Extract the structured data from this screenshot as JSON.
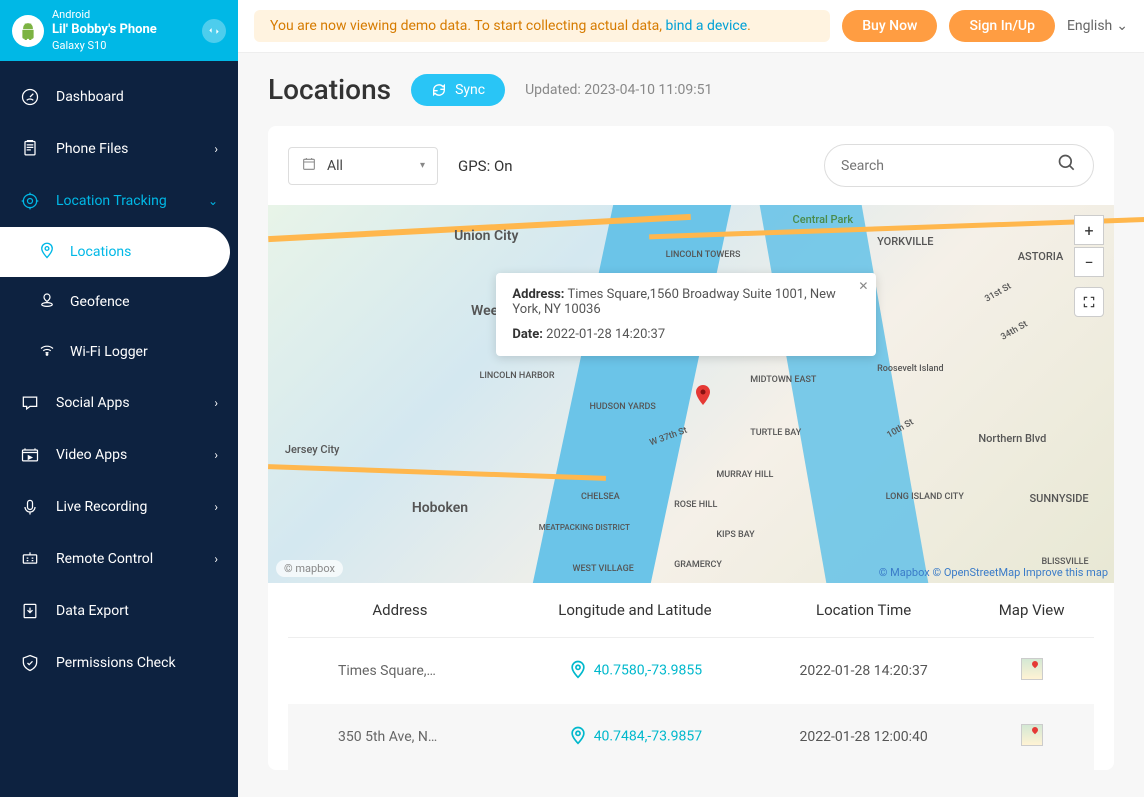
{
  "device": {
    "os": "Android",
    "name": "Lil' Bobby's Phone",
    "model": "Galaxy S10"
  },
  "nav": {
    "dashboard": "Dashboard",
    "phone_files": "Phone Files",
    "location_tracking": "Location Tracking",
    "locations": "Locations",
    "geofence": "Geofence",
    "wifi_logger": "Wi-Fi Logger",
    "social_apps": "Social Apps",
    "video_apps": "Video Apps",
    "live_recording": "Live Recording",
    "remote_control": "Remote Control",
    "data_export": "Data Export",
    "permissions_check": "Permissions Check"
  },
  "banner": {
    "notice_pre": "You are now viewing demo data. To start collecting actual data, ",
    "notice_link": "bind a device",
    "notice_post": ".",
    "buy_now": "Buy Now",
    "sign_in_up": "Sign In/Up",
    "language": "English"
  },
  "page": {
    "title": "Locations",
    "sync": "Sync",
    "updated": "Updated: 2023-04-10 11:09:51"
  },
  "toolbar": {
    "filter": "All",
    "gps": "GPS: On",
    "search_placeholder": "Search"
  },
  "map": {
    "popup_address_label": "Address:",
    "popup_address": "Times Square,1560 Broadway Suite 1001, New York, NY 10036",
    "popup_date_label": "Date:",
    "popup_date": "2022-01-28 14:20:37",
    "labels": {
      "union_city": "Union City",
      "central_park": "Central Park",
      "astoria": "ASTORIA",
      "yorkville": "YORKVILLE",
      "lincoln_towers": "LINCOLN TOWERS",
      "weeh": "Weeh",
      "lincoln_harbor": "LINCOLN HARBOR",
      "hudson_yards": "HUDSON YARDS",
      "midtown_east": "MIDTOWN EAST",
      "turtle_bay": "TURTLE BAY",
      "northern_blvd": "Northern Blvd",
      "chelsea": "CHELSEA",
      "rose_hill": "ROSE HILL",
      "sunnyside": "SUNNYSIDE",
      "hoboken": "Hoboken",
      "meatpacking": "MEATPACKING DISTRICT",
      "kips_bay": "KIPS BAY",
      "long_island_city": "LONG ISLAND CITY",
      "west_village": "WEST VILLAGE",
      "gramercy": "GRAMERCY",
      "blissville": "BLISSVILLE",
      "jersey_city": "Jersey City",
      "w37th": "W 37th St",
      "murray_hill": "MURRAY HILL",
      "roosevelt_island": "Roosevelt Island",
      "st31": "31st St",
      "st34": "34th St",
      "st10": "10th St"
    },
    "logo": "© mapbox",
    "attribution_mapbox": "© Mapbox",
    "attribution_osm": "© OpenStreetMap",
    "attribution_improve": "Improve this map"
  },
  "table": {
    "headers": {
      "address": "Address",
      "lonlat": "Longitude and Latitude",
      "time": "Location Time",
      "map_view": "Map View"
    },
    "rows": [
      {
        "address": "Times Square,…",
        "coords": "40.7580,-73.9855",
        "time": "2022-01-28 14:20:37"
      },
      {
        "address": "350 5th Ave, N…",
        "coords": "40.7484,-73.9857",
        "time": "2022-01-28 12:00:40"
      }
    ]
  }
}
